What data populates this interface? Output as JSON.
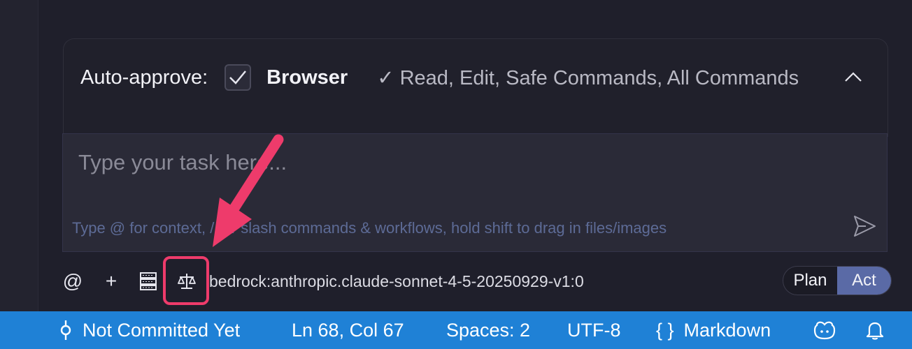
{
  "auto_approve": {
    "label": "Auto-approve:",
    "browser_checked": true,
    "browser_label": "Browser",
    "approved_summary": "✓ Read, Edit, Safe Commands, All Commands"
  },
  "task": {
    "placeholder": "Type your task here...",
    "hint": "Type @ for context, / for slash commands & workflows, hold shift to drag in files/images"
  },
  "toolbar": {
    "at_label": "@",
    "plus_label": "+",
    "model": "bedrock:anthropic.claude-sonnet-4-5-20250929-v1:0",
    "plan_label": "Plan",
    "act_label": "Act"
  },
  "status_bar": {
    "git": "Not Committed Yet",
    "position": "Ln 68, Col 67",
    "spaces": "Spaces: 2",
    "encoding": "UTF-8",
    "language_icon": "{ }",
    "language": "Markdown"
  },
  "colors": {
    "accent": "#5a6aa6",
    "status_bar": "#1f81d6",
    "annotation": "#ee3b6b"
  }
}
